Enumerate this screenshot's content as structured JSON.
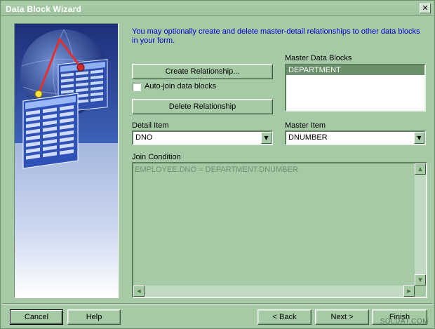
{
  "window": {
    "title": "Data Block Wizard",
    "close_glyph": "✕"
  },
  "intro_text": "You may optionally create and delete master-detail relationships to other data blocks in your form.",
  "buttons": {
    "create_relationship": "Create Relationship...",
    "delete_relationship": "Delete Relationship",
    "cancel": "Cancel",
    "help": "Help",
    "back": "< Back",
    "next": "Next >",
    "finish": "Finish"
  },
  "auto_join": {
    "label": "Auto-join data blocks",
    "checked": false
  },
  "master_data_blocks": {
    "label": "Master Data Blocks",
    "items": [
      "DEPARTMENT"
    ]
  },
  "detail_item": {
    "label": "Detail Item",
    "value": "DNO"
  },
  "master_item": {
    "label": "Master Item",
    "value": "DNUMBER"
  },
  "join_condition": {
    "label": "Join Condition",
    "value": "EMPLOYEE.DNO = DEPARTMENT.DNUMBER"
  },
  "watermark": "SQLDAT.COM",
  "colors": {
    "background": "#a6c9a6",
    "intro_text": "#0000cc",
    "selection": "#6a8f6a",
    "disabled_text": "#6f8f6f"
  },
  "icons": {
    "close": "close-icon",
    "combo_arrow": "chevron-down-icon",
    "scroll_up": "arrow-up-icon",
    "scroll_down": "arrow-down-icon",
    "scroll_left": "arrow-left-icon",
    "scroll_right": "arrow-right-icon"
  }
}
